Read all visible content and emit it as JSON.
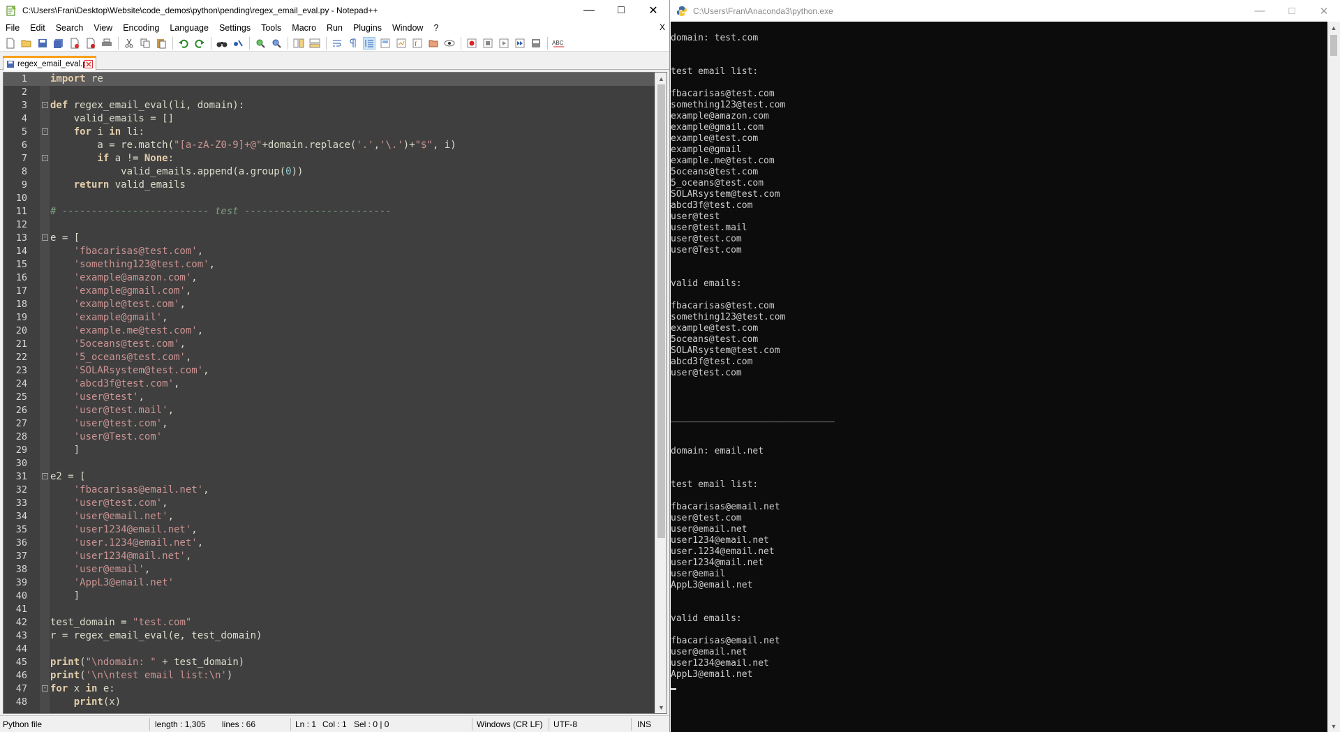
{
  "notepad": {
    "title": "C:\\Users\\Fran\\Desktop\\Website\\code_demos\\python\\pending\\regex_email_eval.py - Notepad++",
    "menu": [
      "File",
      "Edit",
      "Search",
      "View",
      "Encoding",
      "Language",
      "Settings",
      "Tools",
      "Macro",
      "Run",
      "Plugins",
      "Window",
      "?"
    ],
    "menu_close": "X",
    "tab": {
      "label": "regex_email_eval.py"
    },
    "status": {
      "file_type": "Python file",
      "length": "length : 1,305",
      "lines": "lines : 66",
      "ln": "Ln : 1",
      "col": "Col : 1",
      "sel": "Sel : 0 | 0",
      "eol": "Windows (CR LF)",
      "encoding": "UTF-8",
      "mode": "INS"
    },
    "code_lines": [
      {
        "n": "1",
        "fold": "",
        "html": "<span class='kw'>import</span> re",
        "current": true
      },
      {
        "n": "2",
        "fold": "",
        "html": ""
      },
      {
        "n": "3",
        "fold": "-",
        "html": "<span class='kw'>def</span> regex_email_eval(li, domain):"
      },
      {
        "n": "4",
        "fold": "",
        "html": "    valid_emails = []"
      },
      {
        "n": "5",
        "fold": "-",
        "html": "    <span class='kw'>for</span> i <span class='kw'>in</span> li:"
      },
      {
        "n": "6",
        "fold": "",
        "html": "        a = re.match(<span class='str'>\"[a-zA-Z0-9]+@\"</span>+domain.replace(<span class='str'>'.'</span>,<span class='str'>'\\.'</span>)+<span class='str'>\"$\"</span>, i)"
      },
      {
        "n": "7",
        "fold": "-",
        "html": "        <span class='kw'>if</span> a != <span class='kw'>None</span>:"
      },
      {
        "n": "8",
        "fold": "",
        "html": "            valid_emails.append(a.group(<span class='num'>0</span>))"
      },
      {
        "n": "9",
        "fold": "",
        "html": "    <span class='kw'>return</span> valid_emails"
      },
      {
        "n": "10",
        "fold": "",
        "html": ""
      },
      {
        "n": "11",
        "fold": "",
        "html": "<span class='cmt'># ------------------------- test -------------------------</span>"
      },
      {
        "n": "12",
        "fold": "",
        "html": ""
      },
      {
        "n": "13",
        "fold": "-",
        "html": "e = ["
      },
      {
        "n": "14",
        "fold": "",
        "html": "    <span class='str'>'fbacarisas@test.com'</span>,"
      },
      {
        "n": "15",
        "fold": "",
        "html": "    <span class='str'>'something123@test.com'</span>,"
      },
      {
        "n": "16",
        "fold": "",
        "html": "    <span class='str'>'example@amazon.com'</span>,"
      },
      {
        "n": "17",
        "fold": "",
        "html": "    <span class='str'>'example@gmail.com'</span>,"
      },
      {
        "n": "18",
        "fold": "",
        "html": "    <span class='str'>'example@test.com'</span>,"
      },
      {
        "n": "19",
        "fold": "",
        "html": "    <span class='str'>'example@gmail'</span>,"
      },
      {
        "n": "20",
        "fold": "",
        "html": "    <span class='str'>'example.me@test.com'</span>,"
      },
      {
        "n": "21",
        "fold": "",
        "html": "    <span class='str'>'5oceans@test.com'</span>,"
      },
      {
        "n": "22",
        "fold": "",
        "html": "    <span class='str'>'5_oceans@test.com'</span>,"
      },
      {
        "n": "23",
        "fold": "",
        "html": "    <span class='str'>'SOLARsystem@test.com'</span>,"
      },
      {
        "n": "24",
        "fold": "",
        "html": "    <span class='str'>'abcd3f@test.com'</span>,"
      },
      {
        "n": "25",
        "fold": "",
        "html": "    <span class='str'>'user@test'</span>,"
      },
      {
        "n": "26",
        "fold": "",
        "html": "    <span class='str'>'user@test.mail'</span>,"
      },
      {
        "n": "27",
        "fold": "",
        "html": "    <span class='str'>'user@test.com'</span>,"
      },
      {
        "n": "28",
        "fold": "",
        "html": "    <span class='str'>'user@Test.com'</span>"
      },
      {
        "n": "29",
        "fold": "",
        "html": "    ]"
      },
      {
        "n": "30",
        "fold": "",
        "html": ""
      },
      {
        "n": "31",
        "fold": "-",
        "html": "e2 = ["
      },
      {
        "n": "32",
        "fold": "",
        "html": "    <span class='str'>'fbacarisas@email.net'</span>,"
      },
      {
        "n": "33",
        "fold": "",
        "html": "    <span class='str'>'user@test.com'</span>,"
      },
      {
        "n": "34",
        "fold": "",
        "html": "    <span class='str'>'user@email.net'</span>,"
      },
      {
        "n": "35",
        "fold": "",
        "html": "    <span class='str'>'user1234@email.net'</span>,"
      },
      {
        "n": "36",
        "fold": "",
        "html": "    <span class='str'>'user.1234@email.net'</span>,"
      },
      {
        "n": "37",
        "fold": "",
        "html": "    <span class='str'>'user1234@mail.net'</span>,"
      },
      {
        "n": "38",
        "fold": "",
        "html": "    <span class='str'>'user@email'</span>,"
      },
      {
        "n": "39",
        "fold": "",
        "html": "    <span class='str'>'AppL3@email.net'</span>"
      },
      {
        "n": "40",
        "fold": "",
        "html": "    ]"
      },
      {
        "n": "41",
        "fold": "",
        "html": ""
      },
      {
        "n": "42",
        "fold": "",
        "html": "test_domain = <span class='str'>\"test.com\"</span>"
      },
      {
        "n": "43",
        "fold": "",
        "html": "r = regex_email_eval(e, test_domain)"
      },
      {
        "n": "44",
        "fold": "",
        "html": ""
      },
      {
        "n": "45",
        "fold": "",
        "html": "<span class='kw'>print</span>(<span class='str'>\"\\ndomain: \"</span> + test_domain)"
      },
      {
        "n": "46",
        "fold": "",
        "html": "<span class='kw'>print</span>(<span class='str'>'\\n\\ntest email list:\\n'</span>)"
      },
      {
        "n": "47",
        "fold": "-",
        "html": "<span class='kw'>for</span> x <span class='kw'>in</span> e:"
      },
      {
        "n": "48",
        "fold": "",
        "html": "    <span class='kw'>print</span>(x)"
      }
    ]
  },
  "console": {
    "title": "C:\\Users\\Fran\\Anaconda3\\python.exe",
    "lines": [
      "",
      "domain: test.com",
      "",
      "",
      "test email list:",
      "",
      "fbacarisas@test.com",
      "something123@test.com",
      "example@amazon.com",
      "example@gmail.com",
      "example@test.com",
      "example@gmail",
      "example.me@test.com",
      "5oceans@test.com",
      "5_oceans@test.com",
      "SOLARsystem@test.com",
      "abcd3f@test.com",
      "user@test",
      "user@test.mail",
      "user@test.com",
      "user@Test.com",
      "",
      "",
      "valid emails:",
      "",
      "fbacarisas@test.com",
      "something123@test.com",
      "example@test.com",
      "5oceans@test.com",
      "SOLARsystem@test.com",
      "abcd3f@test.com",
      "user@test.com",
      "",
      "",
      "",
      "______________________________",
      "",
      "",
      "domain: email.net",
      "",
      "",
      "test email list:",
      "",
      "fbacarisas@email.net",
      "user@test.com",
      "user@email.net",
      "user1234@email.net",
      "user.1234@email.net",
      "user1234@mail.net",
      "user@email",
      "AppL3@email.net",
      "",
      "",
      "valid emails:",
      "",
      "fbacarisas@email.net",
      "user@email.net",
      "user1234@email.net",
      "AppL3@email.net"
    ]
  },
  "colors": {
    "editor_bg": "#3f3f3f",
    "keyword": "#e3ceab",
    "string": "#cc9393",
    "comment": "#7f9f7f",
    "console_bg": "#0c0c0c",
    "tab_accent": "#f9a11b"
  }
}
